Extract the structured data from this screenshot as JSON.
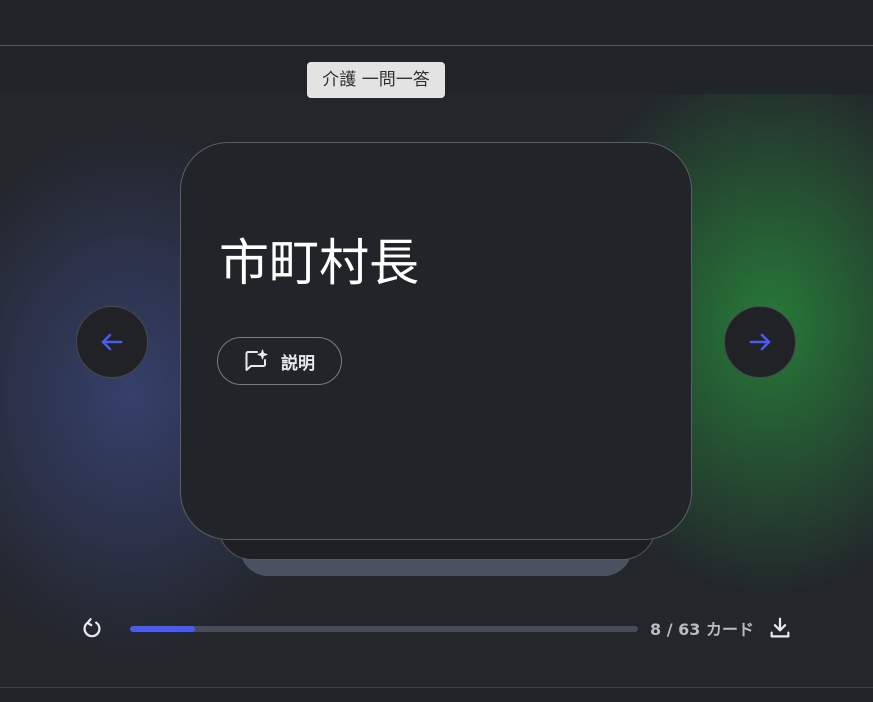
{
  "tooltip": {
    "text": "介護 一問一答"
  },
  "card": {
    "term": "市町村長",
    "explain_label": "説明"
  },
  "navigation": {
    "prev_icon": "arrow-left-icon",
    "next_icon": "arrow-right-icon"
  },
  "progress": {
    "current": 8,
    "total": 63,
    "fraction": 0.127,
    "counter_text": "8 / 63 カード"
  },
  "icons": {
    "reset": "reset-icon",
    "download": "download-icon",
    "explain": "sparkle-chat-icon"
  },
  "colors": {
    "accent": "#4a5bf0",
    "background": "#212429",
    "card": "#212429",
    "glow_left": "#4655a0",
    "glow_right": "#28963c"
  }
}
